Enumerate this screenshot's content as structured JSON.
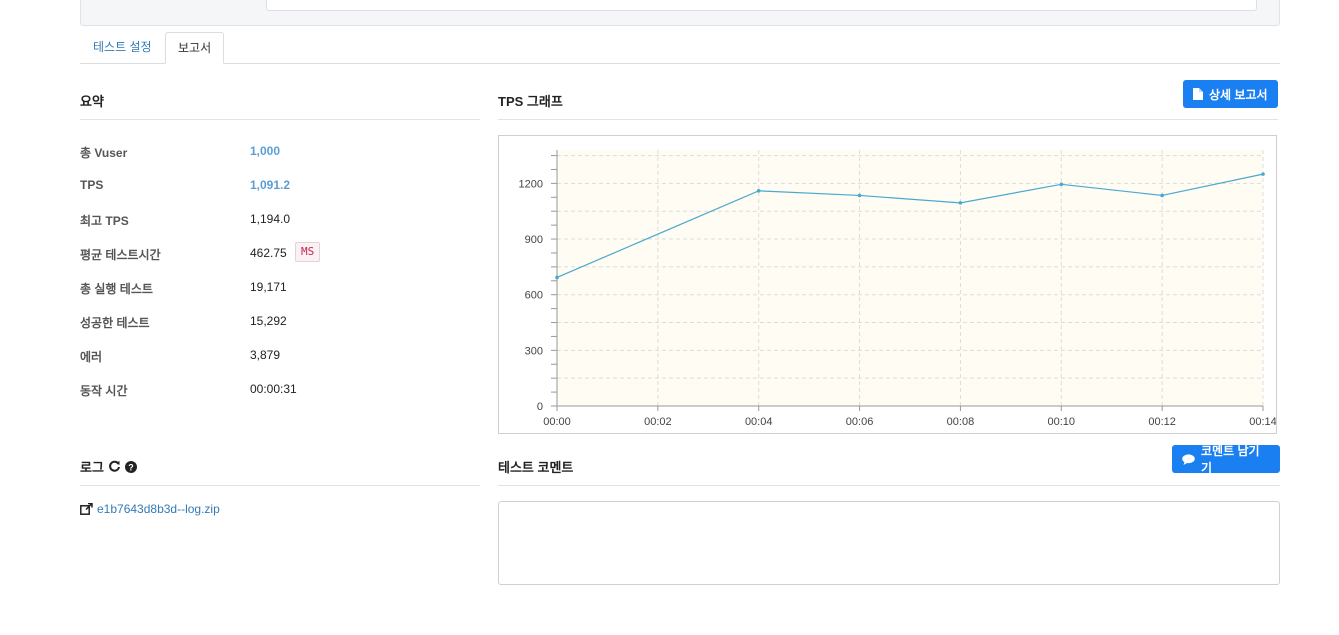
{
  "tabs": {
    "settings": "테스트 설정",
    "report": "보고서"
  },
  "summary": {
    "title": "요약",
    "rows": [
      {
        "label": "총 Vuser",
        "value": "1,000"
      },
      {
        "label": "TPS",
        "value": "1,091.2"
      },
      {
        "label": "최고 TPS",
        "value": "1,194.0"
      },
      {
        "label": "평균 테스트시간",
        "value": "462.75",
        "unit": "MS"
      },
      {
        "label": "총 실행 테스트",
        "value": "19,171"
      },
      {
        "label": "성공한 테스트",
        "value": "15,292"
      },
      {
        "label": "에러",
        "value": "3,879"
      },
      {
        "label": "동작 시간",
        "value": "00:00:31"
      }
    ]
  },
  "graph": {
    "title": "TPS 그래프",
    "detail_button": "상세 보고서"
  },
  "log": {
    "title": "로그",
    "file": "e1b7643d8b3d--log.zip"
  },
  "comment": {
    "title": "테스트 코멘트",
    "button": "코멘트 남기기"
  },
  "colors": {
    "accent": "#1a7ff0",
    "link": "#337ab7",
    "line": "#4aa8d0",
    "plot_bg": "#fefcf3"
  },
  "chart_data": {
    "type": "line",
    "title": "",
    "xlabel": "",
    "ylabel": "",
    "categories": [
      "00:00",
      "00:02",
      "00:04",
      "00:06",
      "00:08",
      "00:10",
      "00:12",
      "00:14"
    ],
    "x": [
      0,
      4,
      6,
      8,
      10,
      12,
      14
    ],
    "x_labels": [
      "00:00",
      "00:04",
      "00:06",
      "00:08",
      "00:10",
      "00:12",
      "00:14"
    ],
    "values": [
      693,
      1160,
      1135,
      1095,
      1195,
      1135,
      1250
    ],
    "ylim": [
      0,
      1380
    ],
    "yticks": [
      0,
      300,
      600,
      900,
      1200
    ],
    "xticks": [
      "00:00",
      "00:02",
      "00:04",
      "00:06",
      "00:08",
      "00:10",
      "00:12",
      "00:14"
    ],
    "grid": true
  }
}
